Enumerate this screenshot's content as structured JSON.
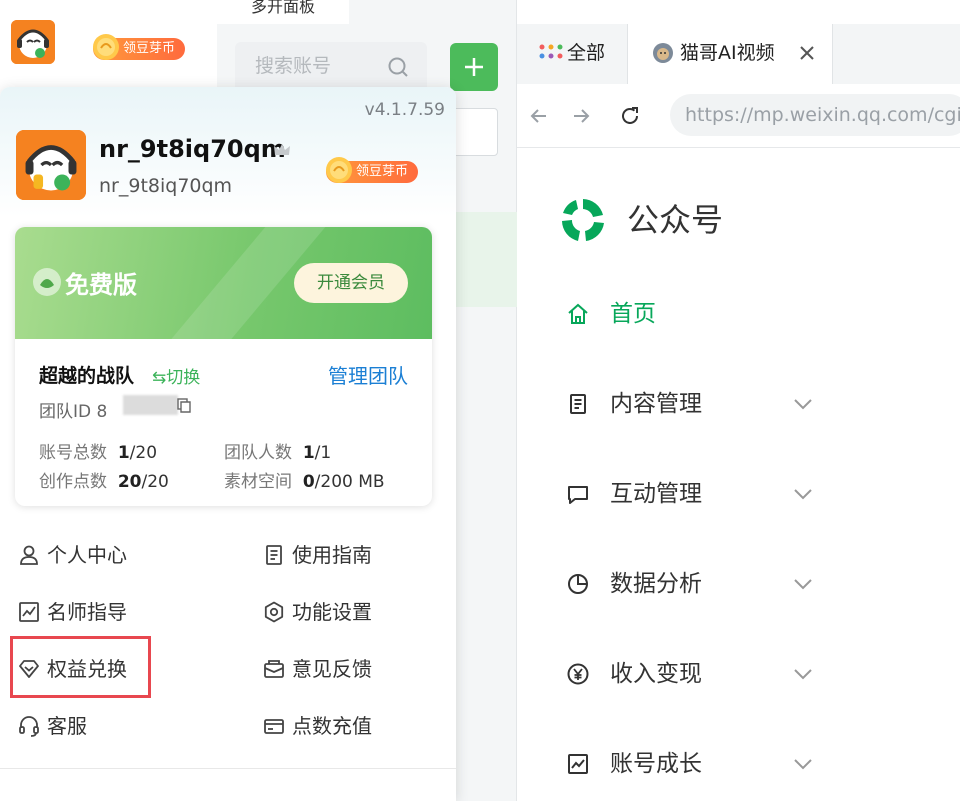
{
  "app": {
    "bean_badge": "领豆芽币"
  },
  "middle": {
    "tab_label": "多开面板",
    "search_placeholder": "搜索账号",
    "add_symbol": "+"
  },
  "browser": {
    "tabs": [
      {
        "label": "全部"
      },
      {
        "label": "猫哥AI视频"
      }
    ],
    "url": "https://mp.weixin.qq.com/cgi-",
    "page_title": "公众号",
    "menu": [
      {
        "label": "首页",
        "icon": "home-icon"
      },
      {
        "label": "内容管理",
        "icon": "document-icon"
      },
      {
        "label": "互动管理",
        "icon": "chat-icon"
      },
      {
        "label": "数据分析",
        "icon": "pie-chart-icon"
      },
      {
        "label": "收入变现",
        "icon": "yen-icon"
      },
      {
        "label": "账号成长",
        "icon": "growth-icon"
      }
    ],
    "colors": {
      "accent": "#07a75a"
    }
  },
  "panel": {
    "version": "v4.1.7.59",
    "user": {
      "name": "nr_9t8iq70qm",
      "id": "nr_9t8iq70qm",
      "bean_badge": "领豆芽币"
    },
    "plan": {
      "label": "免费版",
      "open_button": "开通会员",
      "colors": {
        "band": "#78c86d",
        "button_text": "#3b8a3d"
      }
    },
    "team": {
      "name": "超越的战队",
      "switch_label": "⇆切换",
      "manage_label": "管理团队",
      "id_label": "团队ID 8",
      "stats": [
        {
          "label": "账号总数",
          "value": "1",
          "total": "/20"
        },
        {
          "label": "团队人数",
          "value": "1",
          "total": "/1"
        },
        {
          "label": "创作点数",
          "value": "20",
          "total": "/20"
        },
        {
          "label": "素材空间",
          "value": "0",
          "total": "/200 MB"
        }
      ]
    },
    "quick_links": [
      {
        "label": "个人中心",
        "icon": "user-icon"
      },
      {
        "label": "使用指南",
        "icon": "guide-icon"
      },
      {
        "label": "名师指导",
        "icon": "chart-board-icon"
      },
      {
        "label": "功能设置",
        "icon": "settings-icon"
      },
      {
        "label": "权益兑换",
        "icon": "gem-icon"
      },
      {
        "label": "意见反馈",
        "icon": "feedback-icon"
      },
      {
        "label": "客服",
        "icon": "headset-icon"
      },
      {
        "label": "点数充值",
        "icon": "recharge-icon"
      }
    ],
    "highlight_color": "#e8474f"
  }
}
